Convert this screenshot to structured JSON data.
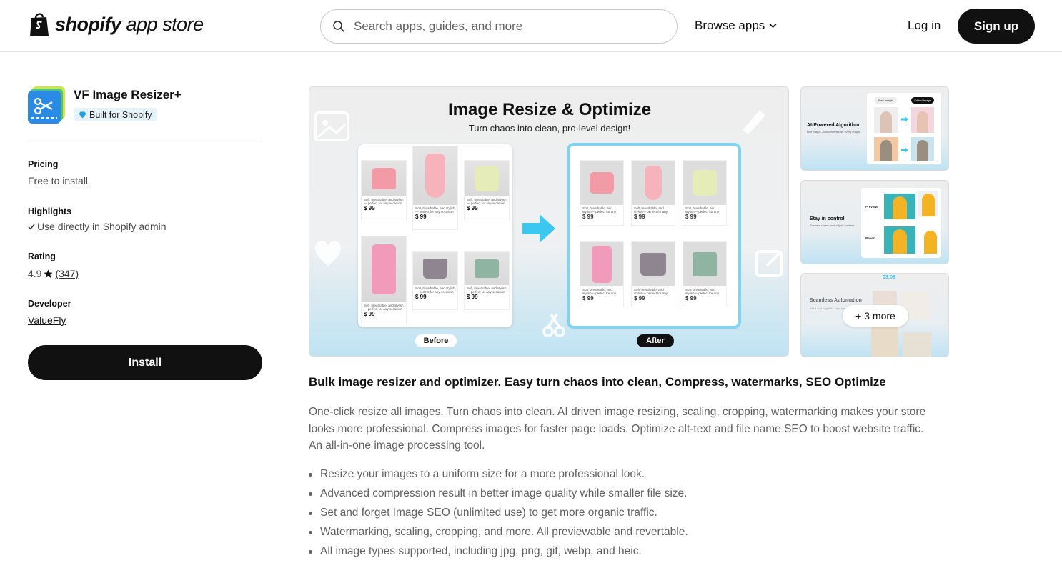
{
  "header": {
    "logo_bold": "shopify",
    "logo_light": " app store",
    "search_placeholder": "Search apps, guides, and more",
    "browse_label": "Browse apps",
    "login_label": "Log in",
    "signup_label": "Sign up"
  },
  "app": {
    "name": "VF Image Resizer+",
    "badge": "Built for Shopify",
    "pricing_label": "Pricing",
    "pricing_value": "Free to install",
    "highlights_label": "Highlights",
    "highlights_value": "Use directly in Shopify admin",
    "rating_label": "Rating",
    "rating_value": "4.9",
    "rating_count": "(347)",
    "developer_label": "Developer",
    "developer_value": "ValueFly",
    "install_label": "Install"
  },
  "hero": {
    "title": "Image Resize & Optimize",
    "subtitle": "Turn chaos into clean, pro-level design!",
    "before_label": "Before",
    "after_label": "After",
    "product_caption": "Soft, breathable, and stylish— perfect for any occasion",
    "price": "$ 99"
  },
  "thumbnails": [
    {
      "title": "AI-Powered Algorithm",
      "sub": "Like magic—custom edits for every image.",
      "tag1": "Raw image",
      "tag2": "Edited image"
    },
    {
      "title": "Stay in control",
      "sub": "Preview, revert, and adjust anytime.",
      "row1": "Preview",
      "row2": "Revert"
    },
    {
      "title": "Seamless Automation",
      "sub": "Set it and forget it—new images processed automatically",
      "more": "+ 3 more",
      "clock": "03:08"
    }
  ],
  "listing": {
    "headline": "Bulk image resizer and optimizer. Easy turn chaos into clean, Compress, watermarks, SEO Optimize",
    "description": "One-click resize all images. Turn chaos into clean. AI driven image resizing, scaling, cropping, watermarking makes your store looks more professional. Compress images for faster page loads. Optimize alt-text and file name SEO to boost website traffic. An all-in-one image processing tool.",
    "features": [
      "Resize your images to a uniform size for a more professional look.",
      "Advanced compression result in better image quality while smaller file size.",
      "Set and forget Image SEO (unlimited use) to get more organic traffic.",
      "Watermarking, scaling, cropping, and more. All previewable and revertable.",
      "All image types supported, including jpg, png, gif, webp, and heic."
    ]
  },
  "colors": {
    "primary_button": "#111111",
    "badge_bg": "#e6f3fb",
    "accent_blue": "#4fc3ea",
    "muted_text": "#616161"
  }
}
